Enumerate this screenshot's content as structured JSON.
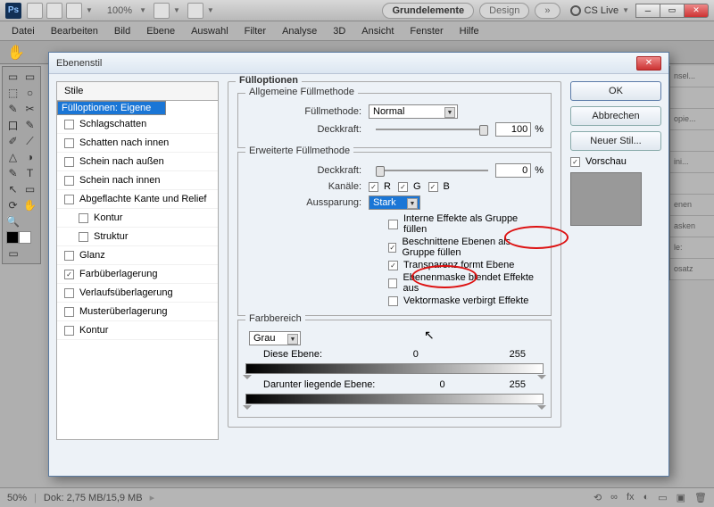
{
  "titlebar": {
    "zoom": "100%",
    "workspace_active": "Grundelemente",
    "workspace2": "Design",
    "cslive": "CS Live"
  },
  "menu": [
    "Datei",
    "Bearbeiten",
    "Bild",
    "Ebene",
    "Auswahl",
    "Filter",
    "Analyse",
    "3D",
    "Ansicht",
    "Fenster",
    "Hilfe"
  ],
  "dialog": {
    "title": "Ebenenstil",
    "styles_header": "Stile",
    "styles": [
      {
        "label": "Fülloptionen: Eigene",
        "sel": true,
        "cb": false
      },
      {
        "label": "Schlagschatten",
        "cb": true,
        "ck": false
      },
      {
        "label": "Schatten nach innen",
        "cb": true,
        "ck": false
      },
      {
        "label": "Schein nach außen",
        "cb": true,
        "ck": false
      },
      {
        "label": "Schein nach innen",
        "cb": true,
        "ck": false
      },
      {
        "label": "Abgeflachte Kante und Relief",
        "cb": true,
        "ck": false
      },
      {
        "label": "Kontur",
        "cb": true,
        "ck": false,
        "sub": true
      },
      {
        "label": "Struktur",
        "cb": true,
        "ck": false,
        "sub": true
      },
      {
        "label": "Glanz",
        "cb": true,
        "ck": false
      },
      {
        "label": "Farbüberlagerung",
        "cb": true,
        "ck": true
      },
      {
        "label": "Verlaufsüberlagerung",
        "cb": true,
        "ck": false
      },
      {
        "label": "Musterüberlagerung",
        "cb": true,
        "ck": false
      },
      {
        "label": "Kontur",
        "cb": true,
        "ck": false
      }
    ],
    "fill_options_title": "Fülloptionen",
    "general": {
      "title": "Allgemeine Füllmethode",
      "blend_label": "Füllmethode:",
      "blend_value": "Normal",
      "opacity_label": "Deckkraft:",
      "opacity_value": "100",
      "pct": "%"
    },
    "advanced": {
      "title": "Erweiterte Füllmethode",
      "opacity_label": "Deckkraft:",
      "opacity_value": "0",
      "pct": "%",
      "channels_label": "Kanäle:",
      "r": "R",
      "g": "G",
      "b": "B",
      "knockout_label": "Aussparung:",
      "knockout_value": "Stark",
      "opts": [
        {
          "label": "Interne Effekte als Gruppe füllen",
          "ck": false
        },
        {
          "label": "Beschnittene Ebenen als Gruppe füllen",
          "ck": true
        },
        {
          "label": "Transparenz formt Ebene",
          "ck": true
        },
        {
          "label": "Ebenenmaske blendet Effekte aus",
          "ck": false
        },
        {
          "label": "Vektormaske verbirgt Effekte",
          "ck": false
        }
      ]
    },
    "blendif": {
      "title": "Farbbereich",
      "channel": "Grau",
      "this_label": "Diese Ebene:",
      "this_lo": "0",
      "this_hi": "255",
      "under_label": "Darunter liegende Ebene:",
      "under_lo": "0",
      "under_hi": "255"
    },
    "buttons": {
      "ok": "OK",
      "cancel": "Abbrechen",
      "newstyle": "Neuer Stil...",
      "preview": "Vorschau"
    }
  },
  "rpanel": [
    "nsel...",
    "",
    "opie...",
    "",
    "ini...",
    "",
    "enen",
    "asken",
    "le:",
    "osatz",
    ""
  ],
  "status": {
    "zoom": "50%",
    "doc": "Dok: 2,75 MB/15,9 MB"
  }
}
